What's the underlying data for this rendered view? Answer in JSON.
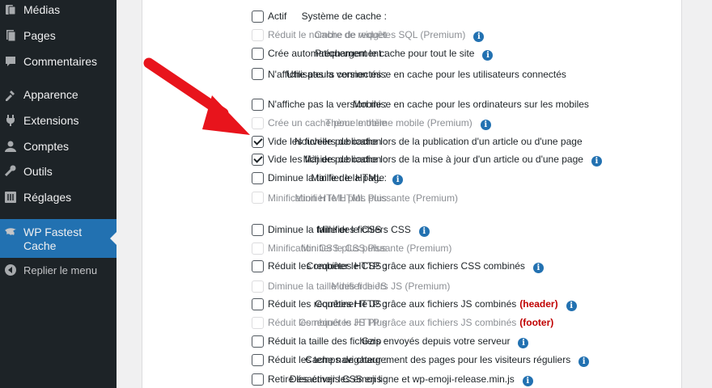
{
  "sidebar": {
    "items": [
      {
        "label": "Médias",
        "icon": "media-icon"
      },
      {
        "label": "Pages",
        "icon": "pages-icon"
      },
      {
        "label": "Commentaires",
        "icon": "comments-icon"
      },
      {
        "label": "Apparence",
        "icon": "appearance-icon"
      },
      {
        "label": "Extensions",
        "icon": "plugins-icon"
      },
      {
        "label": "Comptes",
        "icon": "users-icon"
      },
      {
        "label": "Outils",
        "icon": "tools-icon"
      },
      {
        "label": "Réglages",
        "icon": "settings-icon"
      },
      {
        "label": "WP Fastest Cache",
        "icon": "wpfc-icon",
        "active": true
      }
    ],
    "collapse_label": "Replier le menu"
  },
  "settings": [
    {
      "label": "Système de cache :",
      "desc": "Actif",
      "checked": false,
      "premium": false,
      "info": false
    },
    {
      "label": "Cache de widget",
      "desc": "Réduit le nombre de requêtes SQL (Premium)",
      "checked": false,
      "premium": true,
      "info": true
    },
    {
      "label": "Préchargement :",
      "desc": "Crée automatiquement le cache pour tout le site",
      "checked": false,
      "premium": false,
      "info": true
    },
    {
      "label": "Utilisateurs connectés :",
      "desc": "N'affiche pas la version mise en cache pour les utilisateurs connectés",
      "checked": false,
      "premium": false,
      "info": false
    },
    {
      "label": "Mobile :",
      "desc": "N'affiche pas la version mise en cache pour les ordinateurs sur les mobiles",
      "checked": false,
      "premium": false,
      "info": false
    },
    {
      "label": "Thème mobile",
      "desc": "Crée un cache pour le thème mobile (Premium)",
      "checked": false,
      "premium": true,
      "info": true
    },
    {
      "label": "Nouvelle publication :",
      "desc": "Vide les fichiers de cache lors de la publication d'un article ou d'une page",
      "checked": true,
      "premium": false,
      "info": false
    },
    {
      "label": "Màj de publication :",
      "desc": "Vide les fichiers de cache lors de la mise à jour d'un article ou d'une page",
      "checked": true,
      "premium": false,
      "info": true
    },
    {
      "label": "Minifier le HTML :",
      "desc": "Diminue la taille de la page",
      "checked": false,
      "premium": false,
      "info": true
    },
    {
      "label": "Minifier le HTML Plus",
      "desc": "Minification HTML plus puissante (Premium)",
      "checked": false,
      "premium": true,
      "info": false
    },
    {
      "label": "Minifier le CSS :",
      "desc": "Diminue la taille des fichiers CSS",
      "checked": false,
      "premium": false,
      "info": true
    },
    {
      "label": "Minifier le CSS Plus",
      "desc": "Minification CSS plus puissante (Premium)",
      "checked": false,
      "premium": true,
      "info": false
    },
    {
      "label": "Combiner le CSS :",
      "desc": "Réduit les requêtes HTTP grâce aux fichiers CSS combinés",
      "checked": false,
      "premium": false,
      "info": true
    },
    {
      "label": "Minifier le JS",
      "desc": "Diminue la taille des fichiers JS (Premium)",
      "checked": false,
      "premium": true,
      "info": false
    },
    {
      "label": "Combiner le JS :",
      "desc": "Réduit les requêtes HTTP grâce aux fichiers JS combinés",
      "tag": "(header)",
      "checked": false,
      "premium": false,
      "info": true
    },
    {
      "label": "Combiner le JS Plus",
      "desc": "Réduit les requêtes HTTP grâce aux fichiers JS combinés",
      "tag": "(footer)",
      "checked": false,
      "premium": true,
      "info": false
    },
    {
      "label": "Gzip :",
      "desc": "Réduit la taille des fichiers envoyés depuis votre serveur",
      "checked": false,
      "premium": false,
      "info": true
    },
    {
      "label": "Cache navigateur :",
      "desc": "Réduit les temps de chargement des pages pour les visiteurs réguliers",
      "checked": false,
      "premium": false,
      "info": true
    },
    {
      "label": "Désactiver les émojis :",
      "desc": "Retire les émojis CSS en ligne et wp-emoji-release.min.js",
      "checked": false,
      "premium": false,
      "info": true
    }
  ],
  "info_glyph": "i",
  "colors": {
    "sidebar_bg": "#1d2327",
    "active_bg": "#2271b1",
    "info_blue": "#2271b1",
    "tag_red": "#c00000",
    "arrow_red": "#e8141c"
  }
}
